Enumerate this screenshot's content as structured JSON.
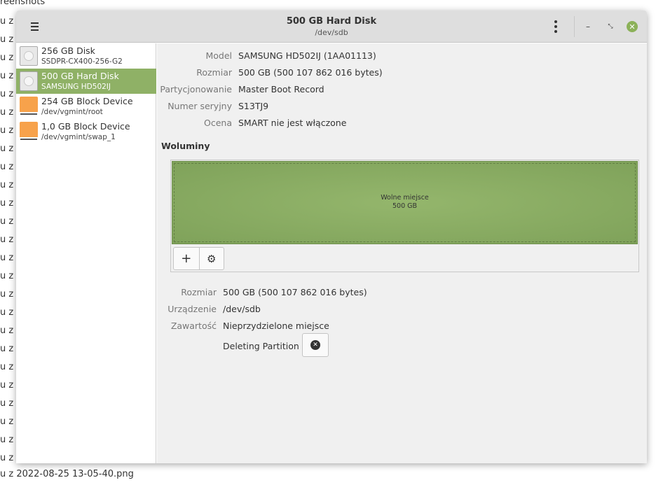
{
  "background": {
    "title_fragment": "reenshots",
    "row_fragment": "u z 2",
    "row_count": 25,
    "bottom_file": "u z 2022-08-25 13-05-40.png"
  },
  "header": {
    "title": "500 GB Hard Disk",
    "subtitle": "/dev/sdb",
    "menu_icon": "hamburger-icon",
    "kebab_icon": "vertical-dots-icon",
    "minimize_glyph": "–",
    "maximize_glyph": "⤡",
    "close_glyph": "✕"
  },
  "sidebar": {
    "items": [
      {
        "name": "256 GB Disk",
        "sub": "SSDPR-CX400-256-G2",
        "icon": "hard-disk-icon",
        "selected": false
      },
      {
        "name": "500 GB Hard Disk",
        "sub": "SAMSUNG HD502IJ",
        "icon": "hard-disk-icon",
        "selected": true
      },
      {
        "name": "254 GB Block Device",
        "sub": "/dev/vgmint/root",
        "icon": "block-device-icon",
        "selected": false
      },
      {
        "name": "1,0 GB Block Device",
        "sub": "/dev/vgmint/swap_1",
        "icon": "block-device-icon",
        "selected": false
      }
    ]
  },
  "disk_info": {
    "model_label": "Model",
    "model_value": "SAMSUNG HD502IJ (1AA01113)",
    "size_label": "Rozmiar",
    "size_value": "500 GB (500 107 862 016 bytes)",
    "partitioning_label": "Partycjonowanie",
    "partitioning_value": "Master Boot Record",
    "serial_label": "Numer seryjny",
    "serial_value": "S13TJ9",
    "assessment_label": "Ocena",
    "assessment_value": "SMART nie jest włączone"
  },
  "volumes": {
    "title": "Woluminy",
    "bar_line1": "Wolne miejsce",
    "bar_line2": "500 GB",
    "add_glyph": "+",
    "settings_glyph": "⚙"
  },
  "volume_info": {
    "size_label": "Rozmiar",
    "size_value": "500 GB (500 107 862 016 bytes)",
    "device_label": "Urządzenie",
    "device_value": "/dev/sdb",
    "contents_label": "Zawartość",
    "contents_value": "Nieprzydzielone miejsce",
    "job_text": "Deleting Partition",
    "cancel_glyph": "✕"
  },
  "colors": {
    "accent": "#8fb166",
    "volume_free": "#8aad63",
    "block_device": "#f7a24b"
  }
}
